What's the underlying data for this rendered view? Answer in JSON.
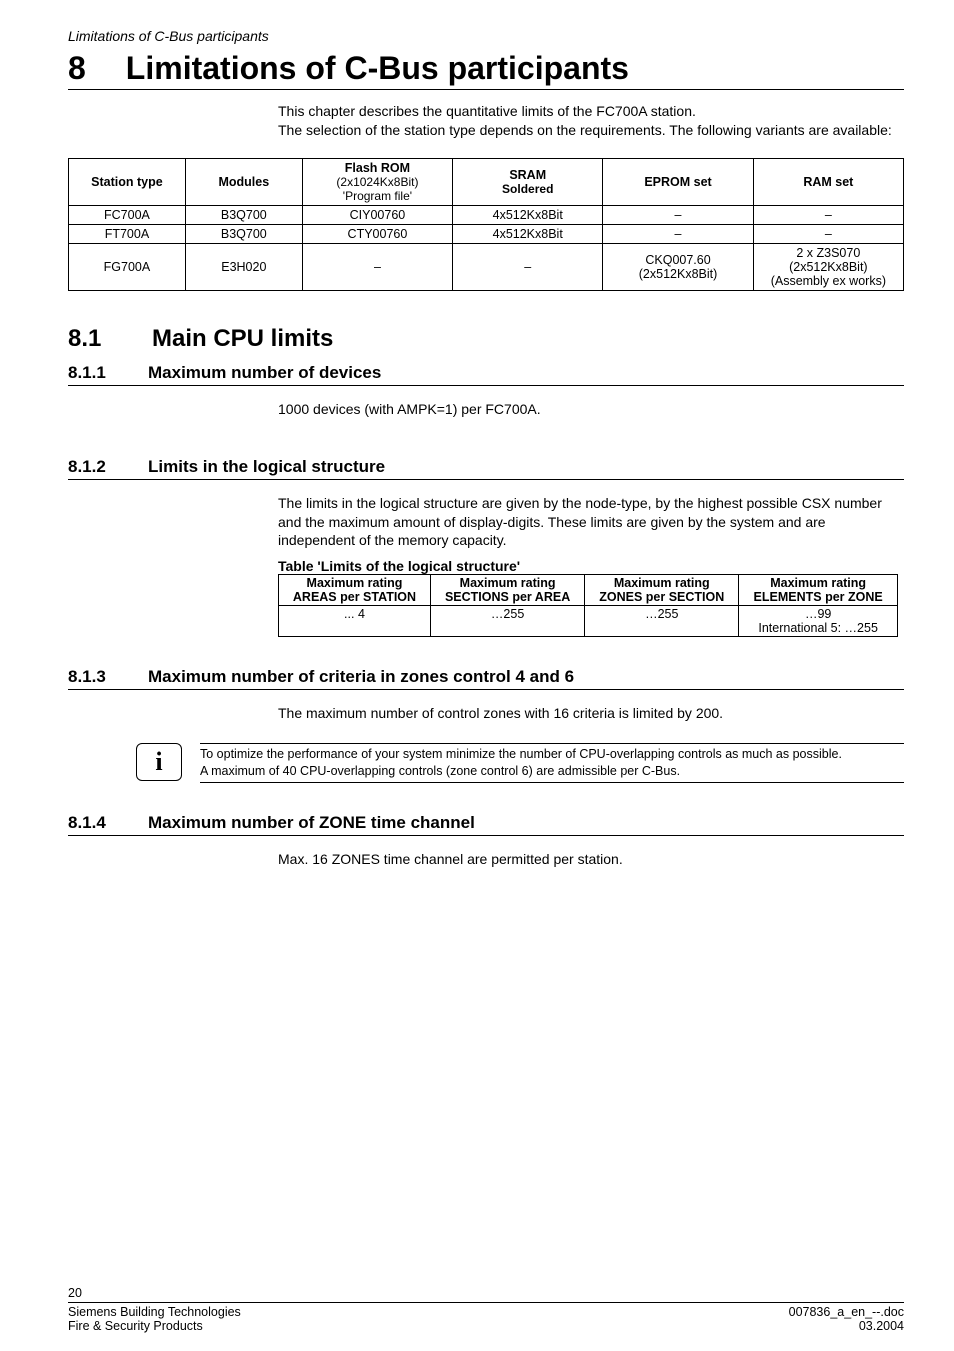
{
  "running_head": "Limitations of C-Bus participants",
  "chapter": {
    "number": "8",
    "title": "Limitations of C-Bus participants"
  },
  "intro": {
    "l1": "This chapter describes the quantitative limits of the FC700A station.",
    "l2": "The selection of the station type depends on the requirements. The following variants are available:"
  },
  "station_table": {
    "headers": {
      "c1": "Station type",
      "c2": "Modules",
      "c3": "Flash ROM",
      "c3a": "(2x1024Kx8Bit)",
      "c3b": "'Program file'",
      "c4": "SRAM",
      "c4a": "Soldered",
      "c5": "EPROM set",
      "c6": "RAM set"
    },
    "rows": [
      {
        "c1": "FC700A",
        "c2": "B3Q700",
        "c3": "CIY00760",
        "c4": "4x512Kx8Bit",
        "c5": "–",
        "c6": "–"
      },
      {
        "c1": "FT700A",
        "c2": "B3Q700",
        "c3": "CTY00760",
        "c4": "4x512Kx8Bit",
        "c5": "–",
        "c6": "–"
      },
      {
        "c1": "FG700A",
        "c2": "E3H020",
        "c3": "–",
        "c4": "–",
        "c5": "CKQ007.60\n(2x512Kx8Bit)",
        "c6": "2 x Z3S070\n(2x512Kx8Bit)\n(Assembly ex works)"
      }
    ]
  },
  "s8_1": {
    "num": "8.1",
    "title": "Main CPU limits"
  },
  "s8_1_1": {
    "num": "8.1.1",
    "title": "Maximum number of devices",
    "body": "1000 devices (with AMPK=1) per FC700A."
  },
  "s8_1_2": {
    "num": "8.1.2",
    "title": "Limits in the logical structure",
    "body": "The limits in the logical structure are given by the node-type, by the highest possible CSX number and the maximum amount of display-digits. These limits are given by the system and are independent of the memory capacity.",
    "table_caption": "Table 'Limits of the logical structure'",
    "table": {
      "headers": {
        "c1a": "Maximum rating",
        "c1b": "AREAS per STATION",
        "c2a": "Maximum rating",
        "c2b": "SECTIONS per AREA",
        "c3a": "Maximum rating",
        "c3b": "ZONES per SECTION",
        "c4a": "Maximum rating",
        "c4b": "ELEMENTS per ZONE"
      },
      "row": {
        "c1": "... 4",
        "c2": "…255",
        "c3": "…255",
        "c4a": "…99",
        "c4b": "International 5: …255"
      }
    }
  },
  "s8_1_3": {
    "num": "8.1.3",
    "title": "Maximum number of criteria in zones control 4 and 6",
    "body": "The maximum number of control zones with 16 criteria is limited by 200.",
    "note_l1": "To optimize the performance of your system minimize the number of CPU-overlapping controls as much as possible.",
    "note_l2": "A maximum of 40 CPU-overlapping controls (zone control 6) are admissible per C-Bus."
  },
  "s8_1_4": {
    "num": "8.1.4",
    "title": "Maximum number of ZONE time channel",
    "body": "Max. 16 ZONES time channel are permitted per station."
  },
  "footer": {
    "page": "20",
    "left1": "Siemens Building Technologies",
    "left2": "Fire & Security Products",
    "right1": "007836_a_en_--.doc",
    "right2": "03.2004"
  },
  "icon_i": "i",
  "chart_data": [
    {
      "type": "table",
      "title": "Station type variants",
      "columns": [
        "Station type",
        "Modules",
        "Flash ROM (2x1024Kx8Bit) 'Program file'",
        "SRAM Soldered",
        "EPROM set",
        "RAM set"
      ],
      "rows": [
        [
          "FC700A",
          "B3Q700",
          "CIY00760",
          "4x512Kx8Bit",
          "–",
          "–"
        ],
        [
          "FT700A",
          "B3Q700",
          "CTY00760",
          "4x512Kx8Bit",
          "–",
          "–"
        ],
        [
          "FG700A",
          "E3H020",
          "–",
          "–",
          "CKQ007.60 (2x512Kx8Bit)",
          "2 x Z3S070 (2x512Kx8Bit) (Assembly ex works)"
        ]
      ]
    },
    {
      "type": "table",
      "title": "Limits of the logical structure",
      "columns": [
        "Maximum rating AREAS per STATION",
        "Maximum rating SECTIONS per AREA",
        "Maximum rating ZONES per SECTION",
        "Maximum rating ELEMENTS per ZONE"
      ],
      "rows": [
        [
          "... 4",
          "…255",
          "…255",
          "…99 / International 5: …255"
        ]
      ]
    }
  ]
}
